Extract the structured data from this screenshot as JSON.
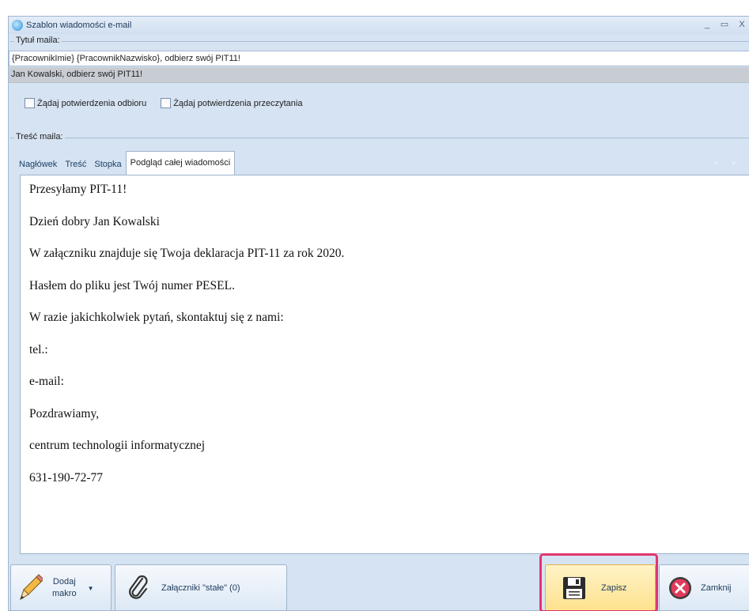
{
  "window": {
    "title": "Szablon wiadomości e-mail",
    "minimize": "_",
    "maximize": "▭",
    "close": "X"
  },
  "subject_group": {
    "label": "Tytuł maila:",
    "template_value": "{PracownikImie} {PracownikNazwisko}, odbierz swój PIT11!",
    "preview_value": "Jan Kowalski, odbierz swój PIT11!"
  },
  "checkboxes": [
    {
      "label": "Żądaj potwierdzenia odbioru",
      "checked": false
    },
    {
      "label": "Żądaj potwierdzenia przeczytania",
      "checked": false
    }
  ],
  "body_group": {
    "label": "Treść maila:"
  },
  "tabs": [
    {
      "label": "Nagłówek",
      "active": false
    },
    {
      "label": "Treść",
      "active": false
    },
    {
      "label": "Stopka",
      "active": false
    },
    {
      "label": "Podgląd całej wiadomości",
      "active": true
    }
  ],
  "tab_scroll": "◂ ▸",
  "message_lines": [
    "Przesyłamy PIT-11!",
    "Dzień dobry Jan Kowalski",
    "W załączniku znajduje się Twoja deklaracja PIT-11 za rok 2020.",
    "Hasłem do pliku jest Twój numer PESEL.",
    "W razie jakichkolwiek pytań, skontaktuj się z nami:",
    "tel.:",
    "e-mail:",
    "Pozdrawiamy,",
    "centrum technologii informatycznej",
    "631-190-72-77"
  ],
  "toolbar": {
    "add_macro_line1": "Dodaj",
    "add_macro_line2": "makro",
    "attachments_label": "Załączniki \"stałe\" (0)",
    "save_label": "Zapisz",
    "close_label": "Zamknij"
  },
  "colors": {
    "highlight": "#e2356f",
    "window_bg": "#d5e3f2"
  }
}
